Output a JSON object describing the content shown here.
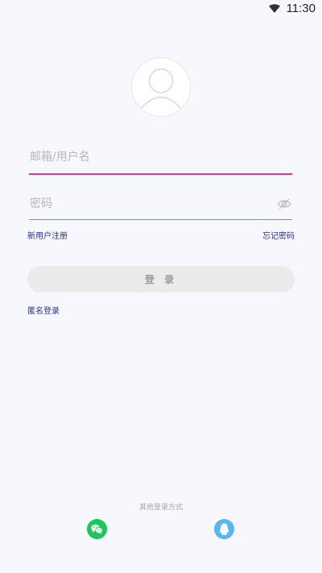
{
  "status_bar": {
    "time": "11:30"
  },
  "form": {
    "email_placeholder": "邮箱/用户名",
    "password_placeholder": "密码",
    "register_link": "新用户注册",
    "forgot_link": "忘记密码",
    "login_button": "登 录",
    "anonymous_link": "匿名登录"
  },
  "social": {
    "title": "其他登录方式",
    "providers": [
      "wechat",
      "qq"
    ],
    "colors": {
      "wechat": "#1FC55B",
      "qq": "#5AB6EF"
    }
  },
  "colors": {
    "background": "#F7F8FE",
    "accent": "#D63A9A",
    "link": "#2D2F86"
  }
}
